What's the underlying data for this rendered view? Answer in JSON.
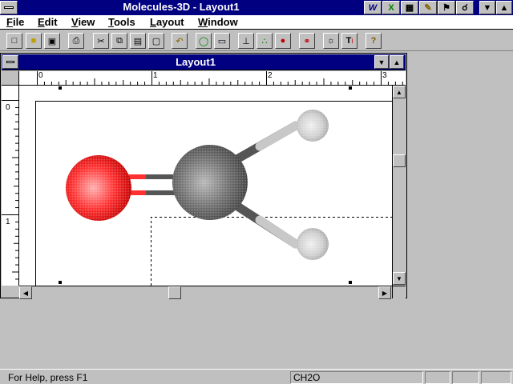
{
  "app": {
    "title": "Molecules-3D - Layout1"
  },
  "menu": {
    "items": [
      {
        "key": "F",
        "rest": "ile"
      },
      {
        "key": "E",
        "rest": "dit"
      },
      {
        "key": "V",
        "rest": "iew"
      },
      {
        "key": "T",
        "rest": "ools"
      },
      {
        "key": "L",
        "rest": "ayout"
      },
      {
        "key": "W",
        "rest": "indow"
      }
    ]
  },
  "taskbar_icons": [
    "word-icon",
    "excel-icon",
    "tool-icon-1",
    "tool-icon-2",
    "tool-icon-3",
    "tool-icon-4"
  ],
  "toolbar": {
    "tools": [
      "new-file",
      "open-folder",
      "save",
      "print",
      "cut",
      "copy",
      "paste",
      "clipboard",
      "undo",
      "ring",
      "chain",
      "bond-axes",
      "molecule-tree",
      "atoms",
      "link",
      "cursor-target",
      "text-tool",
      "help"
    ]
  },
  "child_window": {
    "title": "Layout1",
    "ruler_h": [
      "0",
      "1",
      "2",
      "3"
    ],
    "ruler_v": [
      "0",
      "1"
    ]
  },
  "molecule": {
    "atoms": [
      {
        "element": "O",
        "color": "#ff3030"
      },
      {
        "element": "C",
        "color": "#707070"
      },
      {
        "element": "H",
        "color": "#d8d8d8"
      },
      {
        "element": "H",
        "color": "#d8d8d8"
      }
    ]
  },
  "status": {
    "help": "For Help, press F1",
    "formula": "CH2O"
  }
}
